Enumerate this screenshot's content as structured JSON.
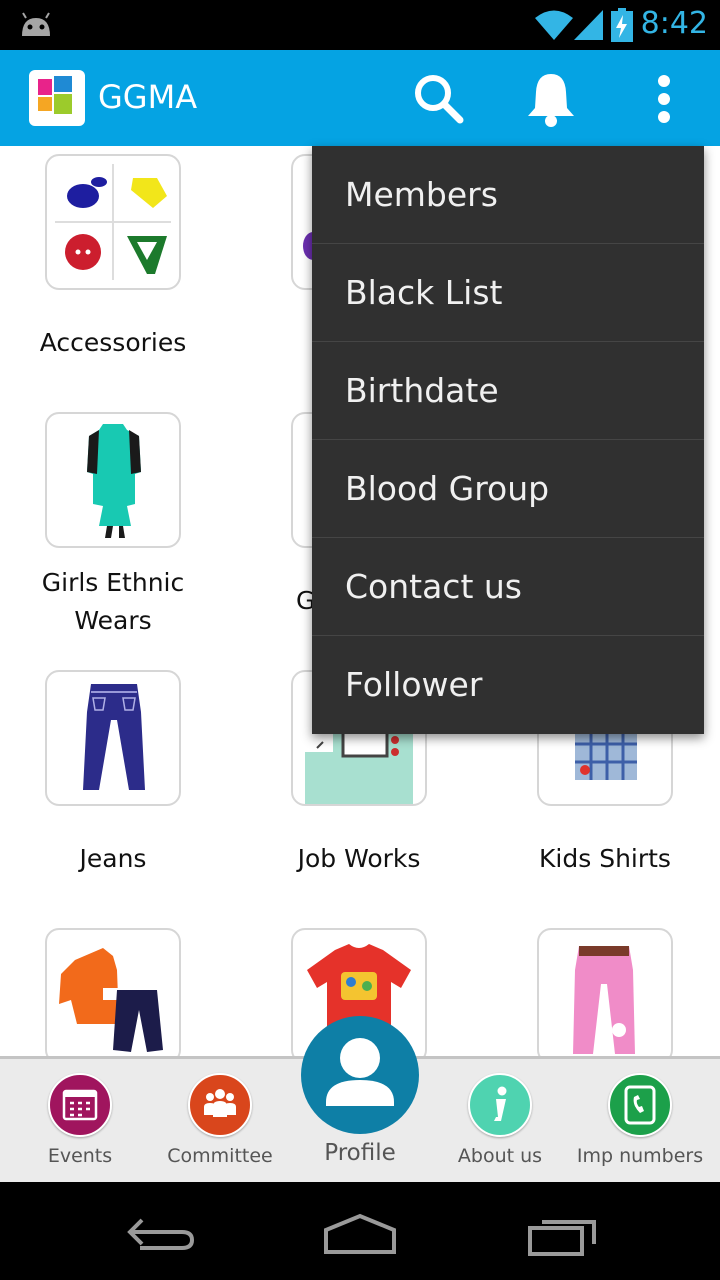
{
  "status_bar": {
    "time": "8:42"
  },
  "app_bar": {
    "title": "GGMA"
  },
  "grid": {
    "tiles": [
      {
        "label": "Accessories"
      },
      {
        "label": "Girls Ethnic\nWears"
      },
      {
        "label": "G"
      },
      {
        "label": "Jeans"
      },
      {
        "label": "Job Works"
      },
      {
        "label": "Kids Shirts"
      }
    ]
  },
  "menu": {
    "items": [
      {
        "label": "Members"
      },
      {
        "label": "Black List"
      },
      {
        "label": "Birthdate"
      },
      {
        "label": "Blood Group"
      },
      {
        "label": "Contact us"
      },
      {
        "label": "Follower"
      }
    ]
  },
  "bottom_nav": {
    "items": [
      {
        "label": "Events",
        "color": "#a0155e"
      },
      {
        "label": "Committee",
        "color": "#d9461c"
      },
      {
        "label": "Profile",
        "color": "#0e7fa6"
      },
      {
        "label": "About us",
        "color": "#4fd3b0"
      },
      {
        "label": "Imp numbers",
        "color": "#1ca04a"
      }
    ]
  },
  "colors": {
    "app_bar": "#05a3e3",
    "status_clock": "#33b5e5"
  }
}
